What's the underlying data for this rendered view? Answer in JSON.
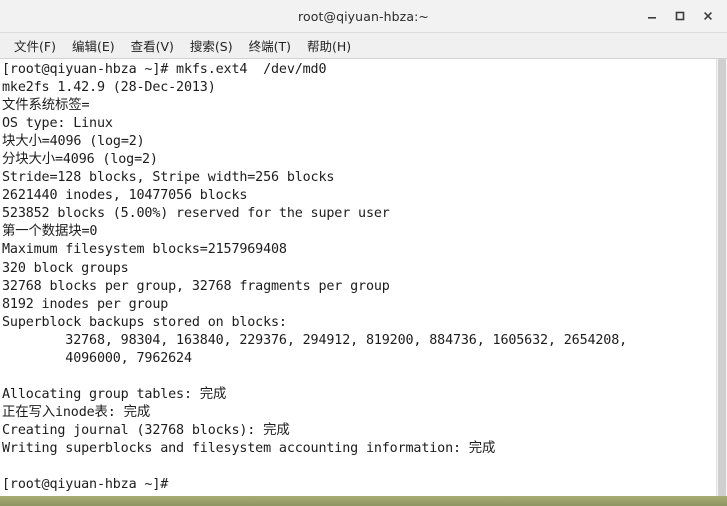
{
  "window": {
    "title": "root@qiyuan-hbza:~",
    "controls": [
      {
        "name": "minimize-button",
        "glyph": "minimize"
      },
      {
        "name": "maximize-button",
        "glyph": "maximize"
      },
      {
        "name": "close-button",
        "glyph": "close"
      }
    ]
  },
  "menubar": {
    "items": [
      {
        "label": "文件(F)"
      },
      {
        "label": "编辑(E)"
      },
      {
        "label": "查看(V)"
      },
      {
        "label": "搜索(S)"
      },
      {
        "label": "终端(T)"
      },
      {
        "label": "帮助(H)"
      }
    ]
  },
  "terminal": {
    "prompt": "[root@qiyuan-hbza ~]# ",
    "command": "mkfs.ext4 /dev/md0",
    "lines": [
      "[root@qiyuan-hbza ~]# mkfs.ext4  /dev/md0",
      "mke2fs 1.42.9 (28-Dec-2013)",
      "文件系统标签=",
      "OS type: Linux",
      "块大小=4096 (log=2)",
      "分块大小=4096 (log=2)",
      "Stride=128 blocks, Stripe width=256 blocks",
      "2621440 inodes, 10477056 blocks",
      "523852 blocks (5.00%) reserved for the super user",
      "第一个数据块=0",
      "Maximum filesystem blocks=2157969408",
      "320 block groups",
      "32768 blocks per group, 32768 fragments per group",
      "8192 inodes per group",
      "Superblock backups stored on blocks:",
      "        32768, 98304, 163840, 229376, 294912, 819200, 884736, 1605632, 2654208,",
      "        4096000, 7962624",
      "",
      "Allocating group tables: 完成",
      "正在写入inode表: 完成",
      "Creating journal (32768 blocks): 完成",
      "Writing superblocks and filesystem accounting information: 完成",
      "",
      "[root@qiyuan-hbza ~]# "
    ]
  },
  "colors": {
    "titlebar_bg": "#f2f2f2",
    "menubar_bg": "#f0f0f0",
    "terminal_bg": "#ffffff",
    "terminal_fg": "#1c1c1c",
    "desktop_bg": "#9aa06a",
    "scrollbar_thumb": "#cfcfcf"
  }
}
